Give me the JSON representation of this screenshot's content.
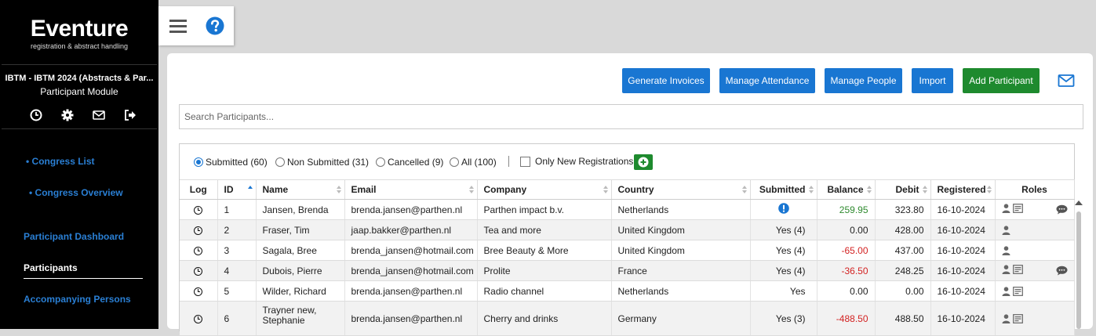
{
  "sidebar": {
    "logo_title": "Eventure",
    "logo_subtitle": "registration & abstract handling",
    "congress": "IBTM - IBTM 2024 (Abstracts & Par...",
    "module": "Participant Module",
    "icons": [
      "clock-icon",
      "gear-icon",
      "envelope-icon",
      "logout-icon"
    ],
    "nav": [
      {
        "label": "• Congress List"
      },
      {
        "label": "• Congress Overview"
      },
      {
        "label": "Participant Dashboard"
      },
      {
        "label": "Participants"
      },
      {
        "label": "Accompanying Persons"
      }
    ]
  },
  "topbar": {
    "icons": [
      "hamburger-menu-icon",
      "help-icon"
    ]
  },
  "colors": {
    "primary": "#1976d2",
    "success": "#1e8a2e",
    "positive": "#2e8a2e",
    "negative": "#d32222"
  },
  "toolbar": {
    "generate_invoices": "Generate Invoices",
    "manage_attendance": "Manage Attendance",
    "manage_people": "Manage People",
    "import": "Import",
    "add_participant": "Add Participant"
  },
  "search": {
    "placeholder": "Search Participants..."
  },
  "filters": {
    "submitted": "Submitted (60)",
    "non_submitted": "Non Submitted (31)",
    "cancelled": "Cancelled (9)",
    "all": "All (100)",
    "selected": "Submitted (60)",
    "only_new": "Only New Registrations"
  },
  "table": {
    "headers": {
      "log": "Log",
      "id": "ID",
      "name": "Name",
      "email": "Email",
      "company": "Company",
      "country": "Country",
      "submitted": "Submitted",
      "balance": "Balance",
      "debit": "Debit",
      "registered": "Registered",
      "roles": "Roles"
    },
    "rows": [
      {
        "id": "1",
        "name": "Jansen, Brenda",
        "email": "brenda.jansen@parthen.nl",
        "company": "Parthen impact b.v.",
        "country": "Netherlands",
        "submitted": "",
        "balance": "259.95",
        "debit": "323.80",
        "registered": "16-10-2024"
      },
      {
        "id": "2",
        "name": "Fraser, Tim",
        "email": "jaap.bakker@parthen.nl",
        "company": "Tea and more",
        "country": "United Kingdom",
        "submitted": "Yes (4)",
        "balance": "0.00",
        "debit": "428.00",
        "registered": "16-10-2024"
      },
      {
        "id": "3",
        "name": "Sagala, Bree",
        "email": "brenda_jansen@hotmail.com",
        "company": "Bree Beauty & More",
        "country": "United Kingdom",
        "submitted": "Yes (4)",
        "balance": "-65.00",
        "debit": "437.00",
        "registered": "16-10-2024"
      },
      {
        "id": "4",
        "name": "Dubois, Pierre",
        "email": "brenda_jansen@hotmail.com",
        "company": "Prolite",
        "country": "France",
        "submitted": "Yes (4)",
        "balance": "-36.50",
        "debit": "248.25",
        "registered": "16-10-2024"
      },
      {
        "id": "5",
        "name": "Wilder, Richard",
        "email": "brenda.jansen@parthen.nl",
        "company": "Radio channel",
        "country": "Netherlands",
        "submitted": "Yes",
        "balance": "0.00",
        "debit": "0.00",
        "registered": "16-10-2024"
      },
      {
        "id": "6",
        "name": "Trayner new, Stephanie",
        "email": "brenda.jansen@parthen.nl",
        "company": "Cherry and drinks",
        "country": "Germany",
        "submitted": "Yes (3)",
        "balance": "-488.50",
        "debit": "488.50",
        "registered": "16-10-2024"
      }
    ]
  }
}
